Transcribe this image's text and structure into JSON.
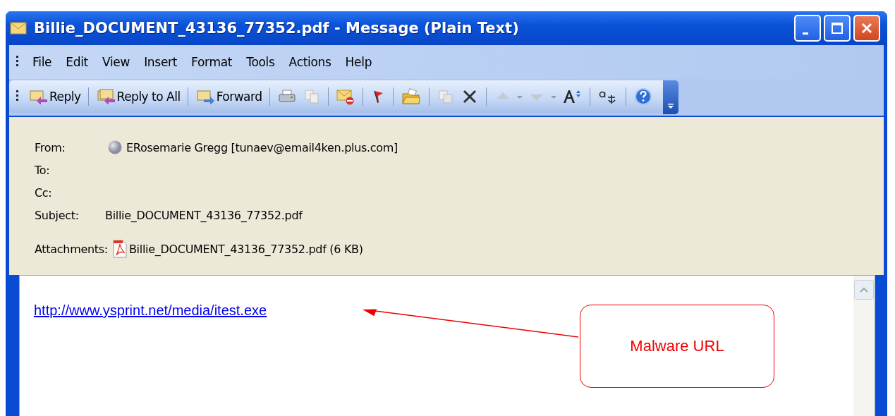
{
  "window": {
    "title": "Billie_DOCUMENT_43136_77352.pdf - Message (Plain Text)"
  },
  "menu": [
    {
      "label": "File"
    },
    {
      "label": "Edit"
    },
    {
      "label": "View"
    },
    {
      "label": "Insert"
    },
    {
      "label": "Format"
    },
    {
      "label": "Tools"
    },
    {
      "label": "Actions"
    },
    {
      "label": "Help"
    }
  ],
  "toolbar": [
    {
      "label": "Reply",
      "kind": "reply"
    },
    {
      "label": "Reply to All",
      "kind": "replyall"
    },
    {
      "label": "Forward",
      "kind": "forward"
    }
  ],
  "header": [
    {
      "label": "From:",
      "value": "ERosemarie Gregg [tunaev@email4ken.plus.com]",
      "kind": "sender"
    },
    {
      "label": "To:"
    },
    {
      "label": "Cc:"
    },
    {
      "label": "Subject:",
      "value": "Billie_DOCUMENT_43136_77352.pdf",
      "kind": "text"
    }
  ],
  "attachments": {
    "label": "Attachments:",
    "file": "Billie_DOCUMENT_43136_77352.pdf (6 KB)"
  },
  "body": {
    "link": "http://www.ysprint.net/media/itest.exe"
  },
  "annotation": {
    "text": "Malware URL"
  }
}
